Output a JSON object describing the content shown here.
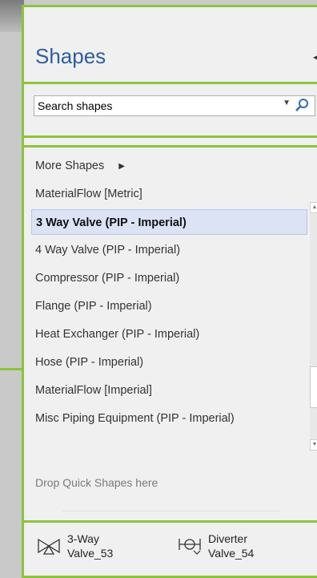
{
  "panel": {
    "title": "Shapes",
    "search_placeholder": "Search shapes"
  },
  "stencils": {
    "more_shapes": "More Shapes",
    "items": [
      "MaterialFlow [Metric]",
      "3 Way Valve (PIP - Imperial)",
      "4 Way Valve (PIP - Imperial)",
      "Compressor (PIP - Imperial)",
      "Flange (PIP - Imperial)",
      "Heat Exchanger (PIP - Imperial)",
      "Hose (PIP - Imperial)",
      "MaterialFlow [Imperial]",
      "Misc Piping Equipment (PIP - Imperial)"
    ],
    "selected_index": 1
  },
  "quick_shapes": {
    "drop_hint": "Drop Quick Shapes here"
  },
  "masters": [
    {
      "line1": "3-Way",
      "line2": "Valve_53",
      "icon": "three-way-valve-icon"
    },
    {
      "line1": "Diverter",
      "line2": "Valve_54",
      "icon": "diverter-valve-icon"
    }
  ],
  "colors": {
    "accent_border": "#8cc43c",
    "title": "#2e5d9f",
    "selected_bg": "#dbe3f5"
  }
}
